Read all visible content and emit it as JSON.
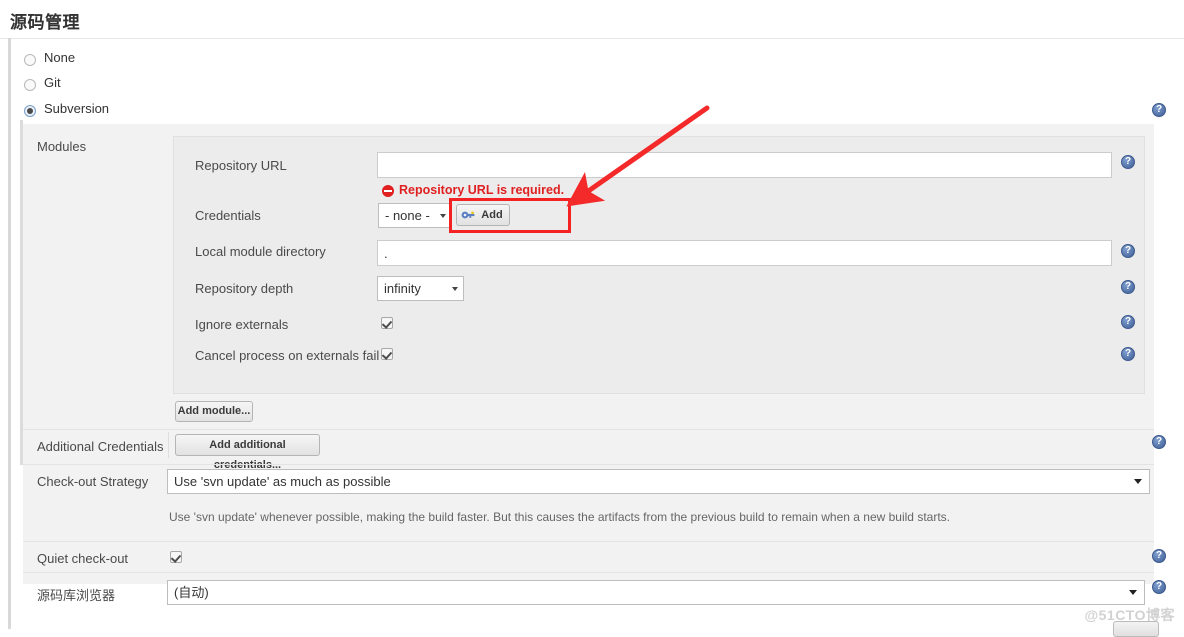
{
  "page": {
    "title": "源码管理",
    "watermark": "@51CTO博客"
  },
  "scm_options": [
    {
      "label": "None",
      "selected": false
    },
    {
      "label": "Git",
      "selected": false
    },
    {
      "label": "Subversion",
      "selected": true
    }
  ],
  "modules": {
    "section_label": "Modules",
    "repository_url": {
      "label": "Repository URL",
      "value": "",
      "placeholder": ""
    },
    "error": {
      "text": "Repository URL is required.",
      "icon": "error-circle-icon",
      "color": "#e02020"
    },
    "credentials": {
      "label": "Credentials",
      "selected": "- none -",
      "add_button_label": "Add",
      "add_button_icon": "key-icon"
    },
    "local_module_directory": {
      "label": "Local module directory",
      "value": "."
    },
    "repository_depth": {
      "label": "Repository depth",
      "selected": "infinity"
    },
    "ignore_externals": {
      "label": "Ignore externals",
      "checked": true
    },
    "cancel_process_on_externals_fail": {
      "label": "Cancel process on externals fail",
      "checked": true
    },
    "add_module_button": "Add module..."
  },
  "additional_credentials": {
    "label": "Additional Credentials",
    "button_label": "Add additional credentials..."
  },
  "checkout_strategy": {
    "label": "Check-out Strategy",
    "selected": "Use 'svn update' as much as possible",
    "help_text": "Use 'svn update' whenever possible, making the build faster. But this causes the artifacts from the previous build to remain when a new build starts."
  },
  "quiet_checkout": {
    "label": "Quiet check-out",
    "checked": true
  },
  "repository_browser": {
    "label": "源码库浏览器",
    "selected": "(自动)"
  },
  "help_icon_glyph": "?",
  "annotation": {
    "highlight_color": "#f42222",
    "arrow_color": "#f42a2a"
  }
}
